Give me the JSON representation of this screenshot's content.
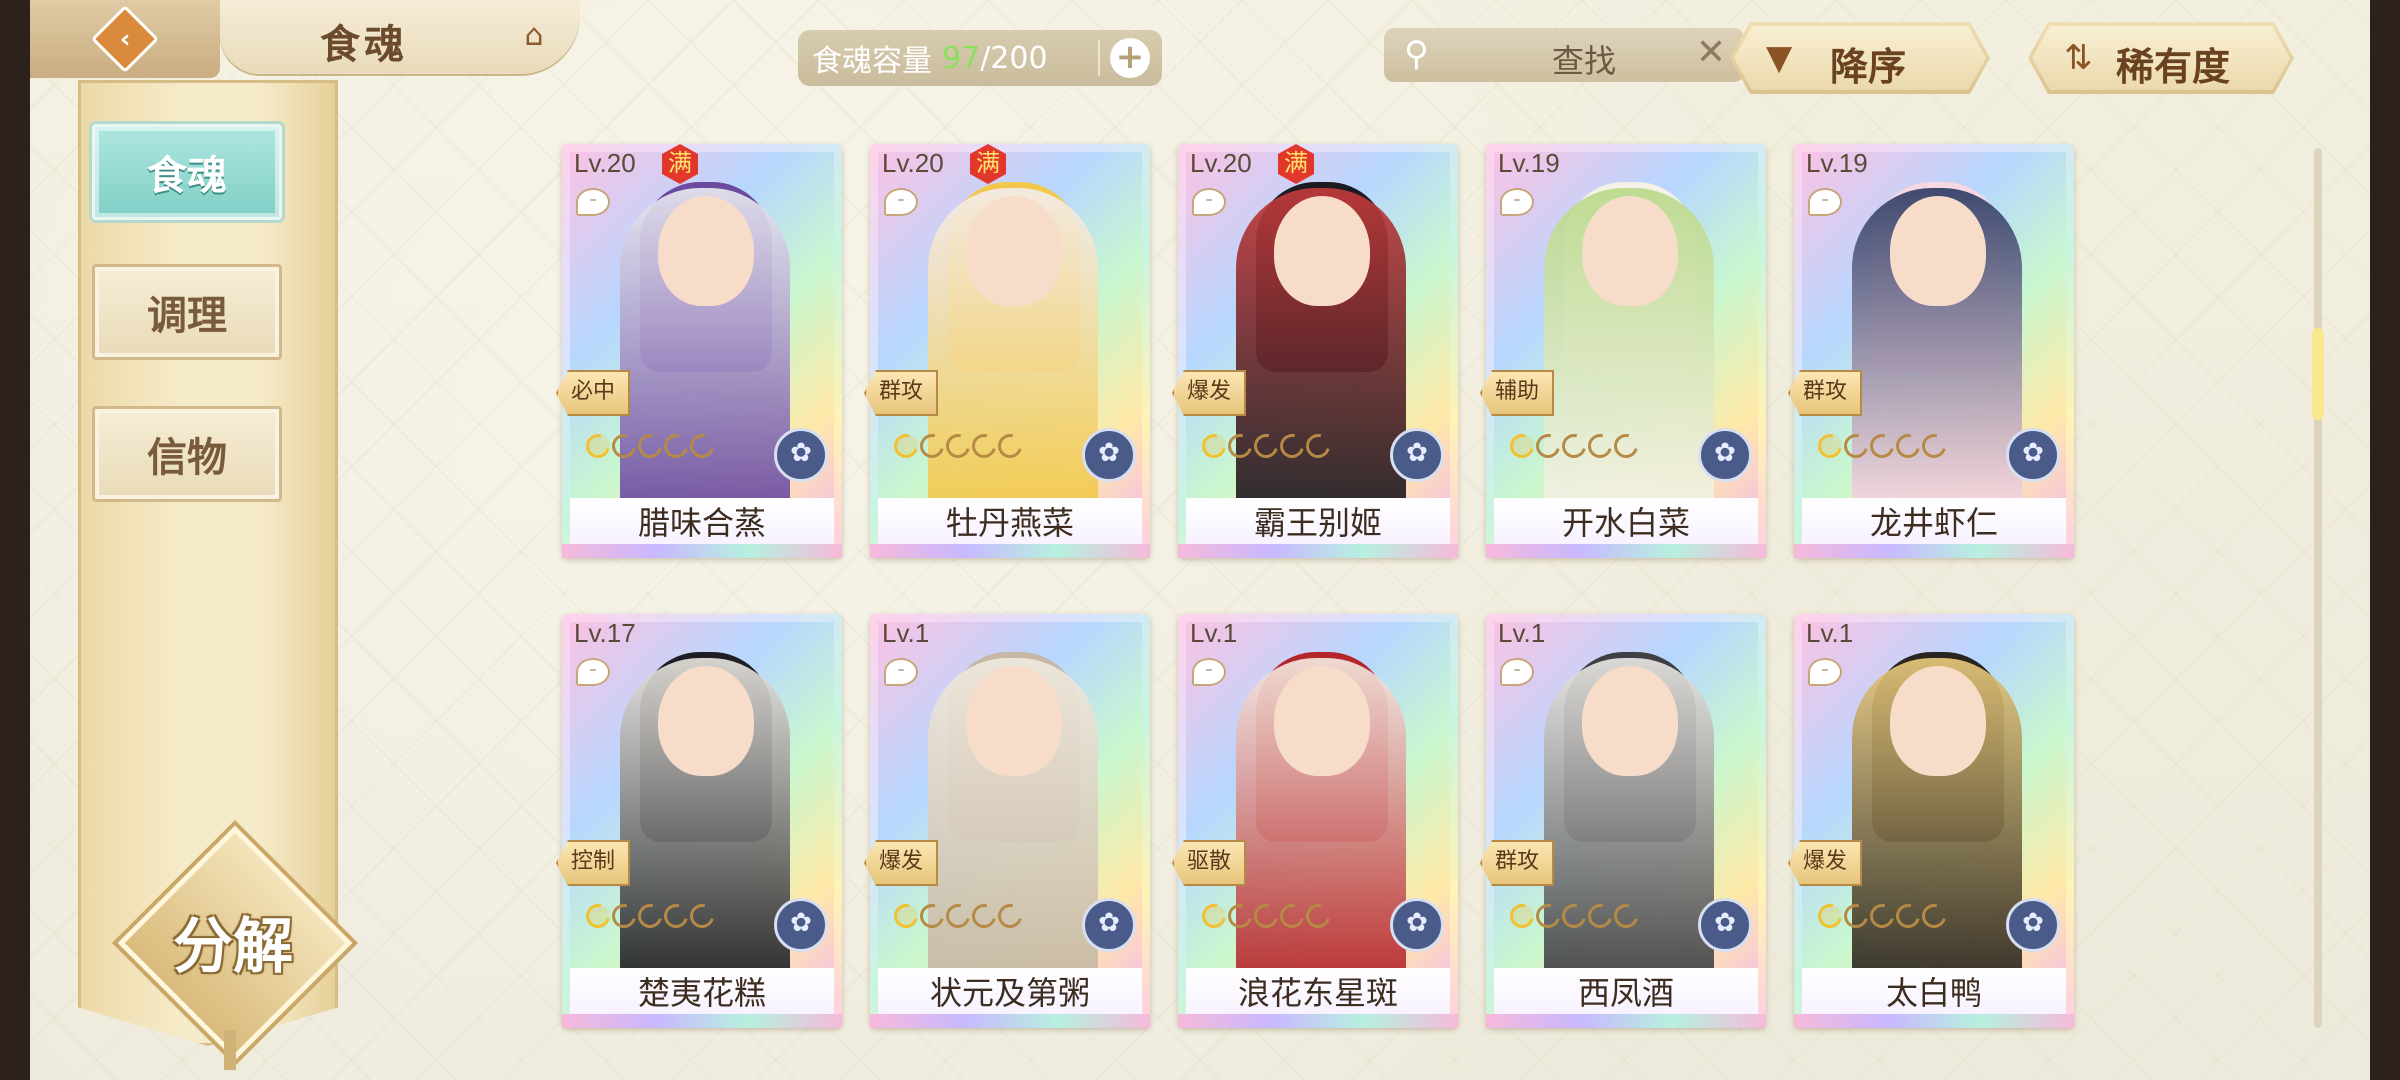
{
  "header": {
    "title": "食魂",
    "back_icon": "back-chevron-icon",
    "home_icon": "pavilion-roof-icon"
  },
  "capacity": {
    "label": "食魂容量",
    "current": "97",
    "separator": "/",
    "max": "200",
    "add_icon": "plus-icon"
  },
  "search": {
    "placeholder": "查找",
    "icon": "search-icon",
    "clear_icon": "close-icon"
  },
  "sort": {
    "order_label": "降序",
    "order_icon": "triangle-down-icon",
    "field_label": "稀有度",
    "field_icon": "swap-arrows-icon"
  },
  "sidebar": {
    "tabs": [
      {
        "label": "食魂",
        "active": true
      },
      {
        "label": "调理",
        "active": false
      },
      {
        "label": "信物",
        "active": false
      }
    ],
    "decompose_label": "分解"
  },
  "colors": {
    "accent_teal": "#7fcfc6",
    "capacity_green": "#8be05b",
    "full_badge": "#e2382c"
  },
  "cards": [
    {
      "level": "Lv.20",
      "full": "满",
      "role": "必中",
      "name": "腊味合蒸",
      "stars": 1,
      "palette": [
        "#6b4aa0",
        "#e8e8f0"
      ]
    },
    {
      "level": "Lv.20",
      "full": "满",
      "role": "群攻",
      "name": "牡丹燕菜",
      "stars": 1,
      "palette": [
        "#f2c84a",
        "#f3ecec"
      ]
    },
    {
      "level": "Lv.20",
      "full": "满",
      "role": "爆发",
      "name": "霸王别姬",
      "stars": 1,
      "palette": [
        "#1c1b22",
        "#c33a3a"
      ]
    },
    {
      "level": "Lv.19",
      "full": "",
      "role": "辅助",
      "name": "开水白菜",
      "stars": 1,
      "palette": [
        "#f4f1e6",
        "#b9d98a"
      ]
    },
    {
      "level": "Lv.19",
      "full": "",
      "role": "群攻",
      "name": "龙井虾仁",
      "stars": 1,
      "palette": [
        "#f7d7e1",
        "#2f3e66"
      ]
    },
    {
      "level": "Lv.17",
      "full": "",
      "role": "控制",
      "name": "楚夷花糕",
      "stars": 1,
      "palette": [
        "#1e1e24",
        "#e6e3dc"
      ]
    },
    {
      "level": "Lv.1",
      "full": "",
      "role": "爆发",
      "name": "状元及第粥",
      "stars": 1,
      "palette": [
        "#c6b8a4",
        "#efe9de"
      ]
    },
    {
      "level": "Lv.1",
      "full": "",
      "role": "驱散",
      "name": "浪花东星斑",
      "stars": 1,
      "palette": [
        "#b5262b",
        "#f4e9e0"
      ]
    },
    {
      "level": "Lv.1",
      "full": "",
      "role": "群攻",
      "name": "西凤酒",
      "stars": 1,
      "palette": [
        "#3f3f44",
        "#e8e6e1"
      ]
    },
    {
      "level": "Lv.1",
      "full": "",
      "role": "爆发",
      "name": "太白鸭",
      "stars": 1,
      "palette": [
        "#2a2520",
        "#e7c87a"
      ]
    }
  ]
}
